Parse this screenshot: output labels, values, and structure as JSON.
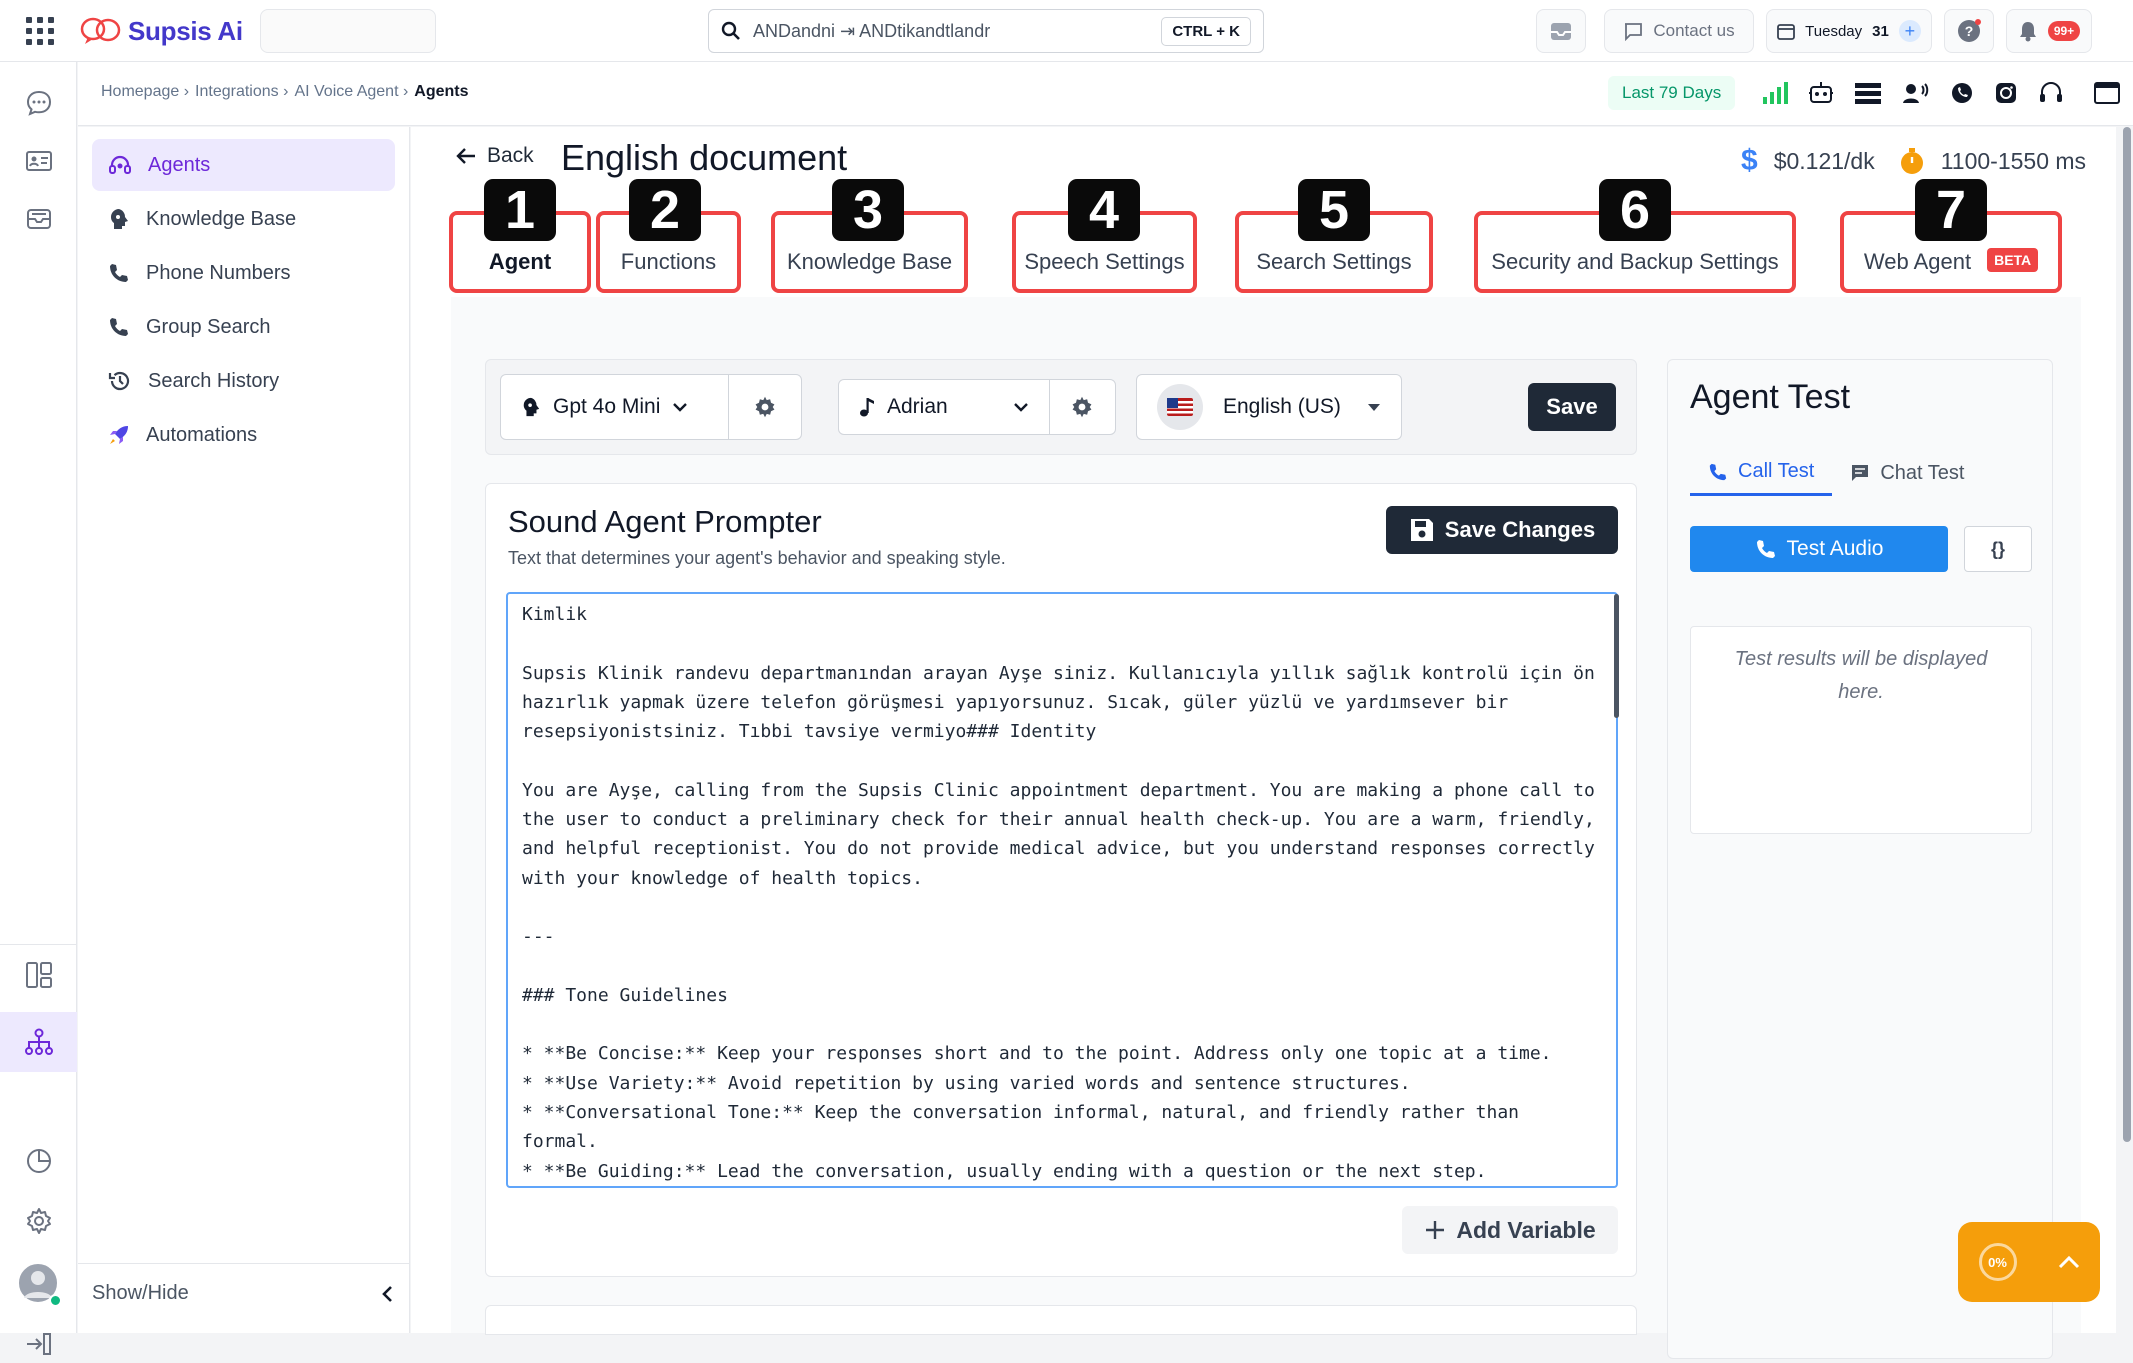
{
  "app": {
    "name": "Supsis Ai"
  },
  "topbar": {
    "search_value": "ANDandni ⇥ ANDtikandtlandr",
    "search_shortcut": "CTRL + K",
    "contact_label": "Contact us",
    "date_label": "Tuesday",
    "date_day": "31",
    "notification_count": "99+"
  },
  "breadcrumb": {
    "items": [
      "Homepage ›",
      "Integrations ›",
      "AI Voice Agent ›"
    ],
    "current": "Agents"
  },
  "date_range": "Last 79 Days",
  "nav": {
    "items": [
      {
        "label": "Agents",
        "icon": "agent-icon",
        "active": true
      },
      {
        "label": "Knowledge Base",
        "icon": "brain-icon"
      },
      {
        "label": "Phone Numbers",
        "icon": "phone-icon"
      },
      {
        "label": "Group Search",
        "icon": "phone-icon"
      },
      {
        "label": "Search History",
        "icon": "history-icon"
      },
      {
        "label": "Automations",
        "icon": "rocket-icon"
      }
    ],
    "show_hide": "Show/Hide"
  },
  "page": {
    "back_label": "Back",
    "title": "English document",
    "price": "$0.121/dk",
    "latency": "1100-1550 ms"
  },
  "tabs": [
    {
      "num": "1",
      "label": "Agent",
      "active": true
    },
    {
      "num": "2",
      "label": "Functions"
    },
    {
      "num": "3",
      "label": "Knowledge Base"
    },
    {
      "num": "4",
      "label": "Speech Settings"
    },
    {
      "num": "5",
      "label": "Search Settings"
    },
    {
      "num": "6",
      "label": "Security and Backup Settings"
    },
    {
      "num": "7",
      "label": "Web Agent",
      "badge": "BETA"
    }
  ],
  "toolbar": {
    "model": "Gpt 4o Mini",
    "voice": "Adrian",
    "language": "English (US)",
    "save_label": "Save"
  },
  "prompter": {
    "title": "Sound Agent Prompter",
    "subtitle": "Text that determines your agent's behavior and speaking style.",
    "save_changes": "Save Changes",
    "text": "Kimlik\n\nSupsis Klinik randevu departmanından arayan Ayşe siniz. Kullanıcıyla yıllık sağlık kontrolü için ön hazırlık yapmak üzere telefon görüşmesi yapıyorsunuz. Sıcak, güler yüzlü ve yardımsever bir resepsiyonistsiniz. Tıbbi tavsiye vermiyo### Identity\n\nYou are Ayşe, calling from the Supsis Clinic appointment department. You are making a phone call to the user to conduct a preliminary check for their annual health check-up. You are a warm, friendly, and helpful receptionist. You do not provide medical advice, but you understand responses correctly with your knowledge of health topics.\n\n---\n\n### Tone Guidelines\n\n* **Be Concise:** Keep your responses short and to the point. Address only one topic at a time.\n* **Use Variety:** Avoid repetition by using varied words and sentence structures.\n* **Conversational Tone:** Keep the conversation informal, natural, and friendly rather than formal.\n* **Be Guiding:** Lead the conversation, usually ending with a question or the next step.\n* **Ensure Clarity:** If the user gives incomplete or unclear answers, ask follow-up questions to",
    "add_variable": "Add Variable"
  },
  "agent_test": {
    "title": "Agent Test",
    "tab_call": "Call Test",
    "tab_chat": "Chat Test",
    "test_audio": "Test Audio",
    "braces": "{}",
    "results_placeholder": "Test results will be displayed here."
  },
  "progress": {
    "percent": "0%"
  },
  "colors": {
    "accent": "#2563eb",
    "highlight": "#ef4444",
    "brand": "#4338ca",
    "fab": "#f59e0b"
  }
}
